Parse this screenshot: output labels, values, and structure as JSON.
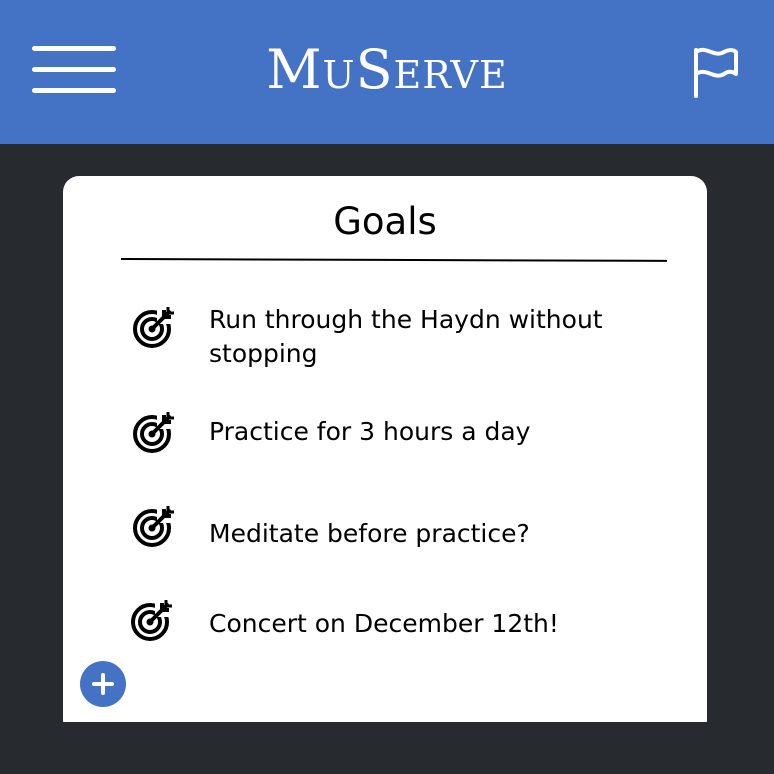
{
  "header": {
    "app_name": "MuServe",
    "menu_icon": "hamburger-menu-icon",
    "flag_icon": "flag-icon",
    "background_color": "#4472c4"
  },
  "goals": {
    "title": "Goals",
    "item_icon": "target-arrow-icon",
    "items": [
      {
        "text": "Run through the Haydn without stopping"
      },
      {
        "text": "Practice for 3 hours a day"
      },
      {
        "text": "Meditate before practice?"
      },
      {
        "text": "Concert on December 12th!"
      }
    ]
  },
  "add_button": {
    "icon": "plus-icon",
    "color": "#4472c4"
  },
  "colors": {
    "background": "#272a2f",
    "card": "#ffffff"
  }
}
